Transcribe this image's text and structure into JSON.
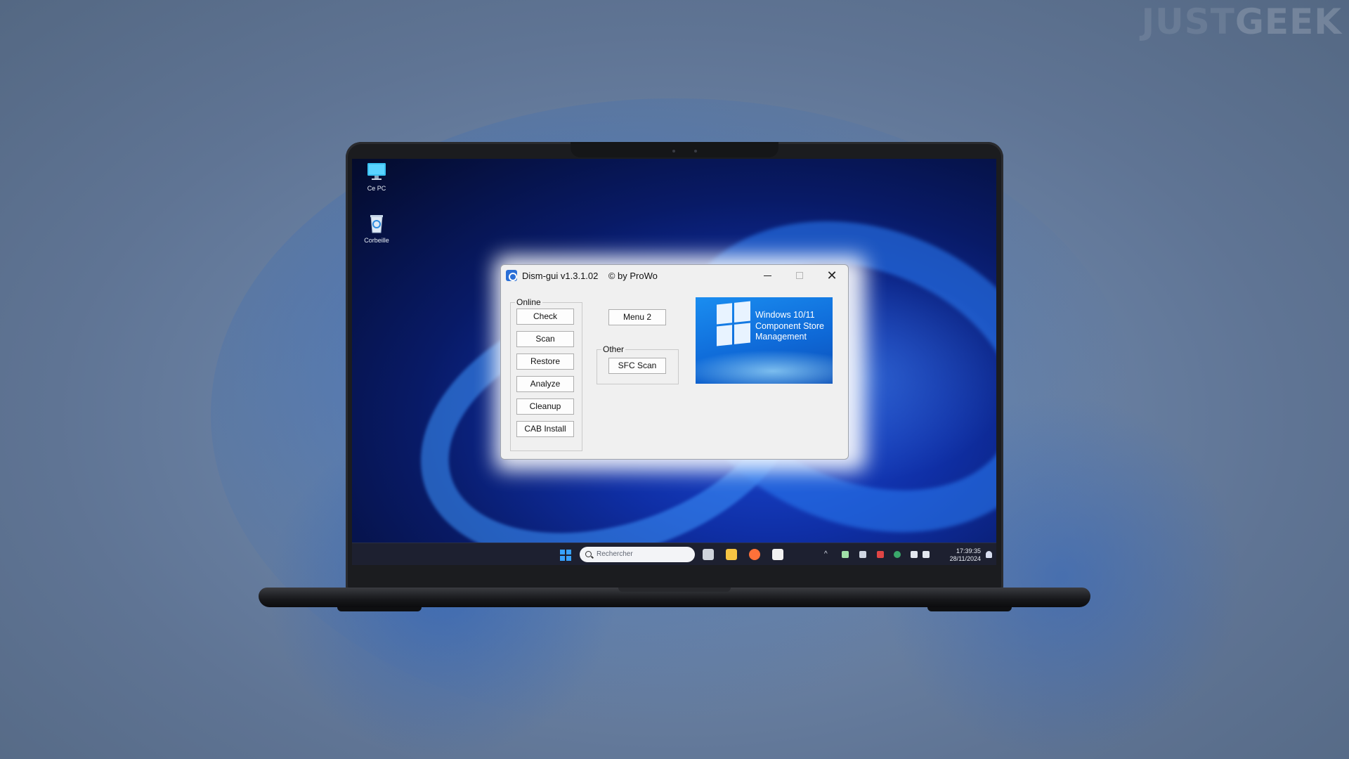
{
  "watermark": {
    "part1": "JUST",
    "part2": "GEEK"
  },
  "desktop": {
    "icons": [
      {
        "label": "Ce PC",
        "icon": "computer-icon"
      },
      {
        "label": "Corbeille",
        "icon": "recycle-bin-icon"
      }
    ]
  },
  "window": {
    "title": "Dism-gui v1.3.1.02    © by ProWo",
    "controls": {
      "minimize": "—",
      "maximize": "□",
      "close": "✕"
    },
    "online_group": {
      "label": "Online",
      "buttons": [
        "Check",
        "Scan",
        "Restore",
        "Analyze",
        "Cleanup",
        "CAB Install"
      ]
    },
    "menu2_label": "Menu 2",
    "other_group": {
      "label": "Other",
      "button": "SFC Scan"
    },
    "banner": {
      "line1": "Windows 10/11",
      "line2": "Component Store",
      "line3": "Management"
    }
  },
  "taskbar": {
    "search_placeholder": "Rechercher",
    "apps": [
      "task-view-icon",
      "file-explorer-icon",
      "firefox-icon",
      "store-icon"
    ],
    "time": "17:39:35",
    "date": "28/11/2024"
  },
  "colors": {
    "accent": "#1a8df0",
    "taskbar": "#1d2030",
    "window_bg": "#f0f0f0"
  }
}
